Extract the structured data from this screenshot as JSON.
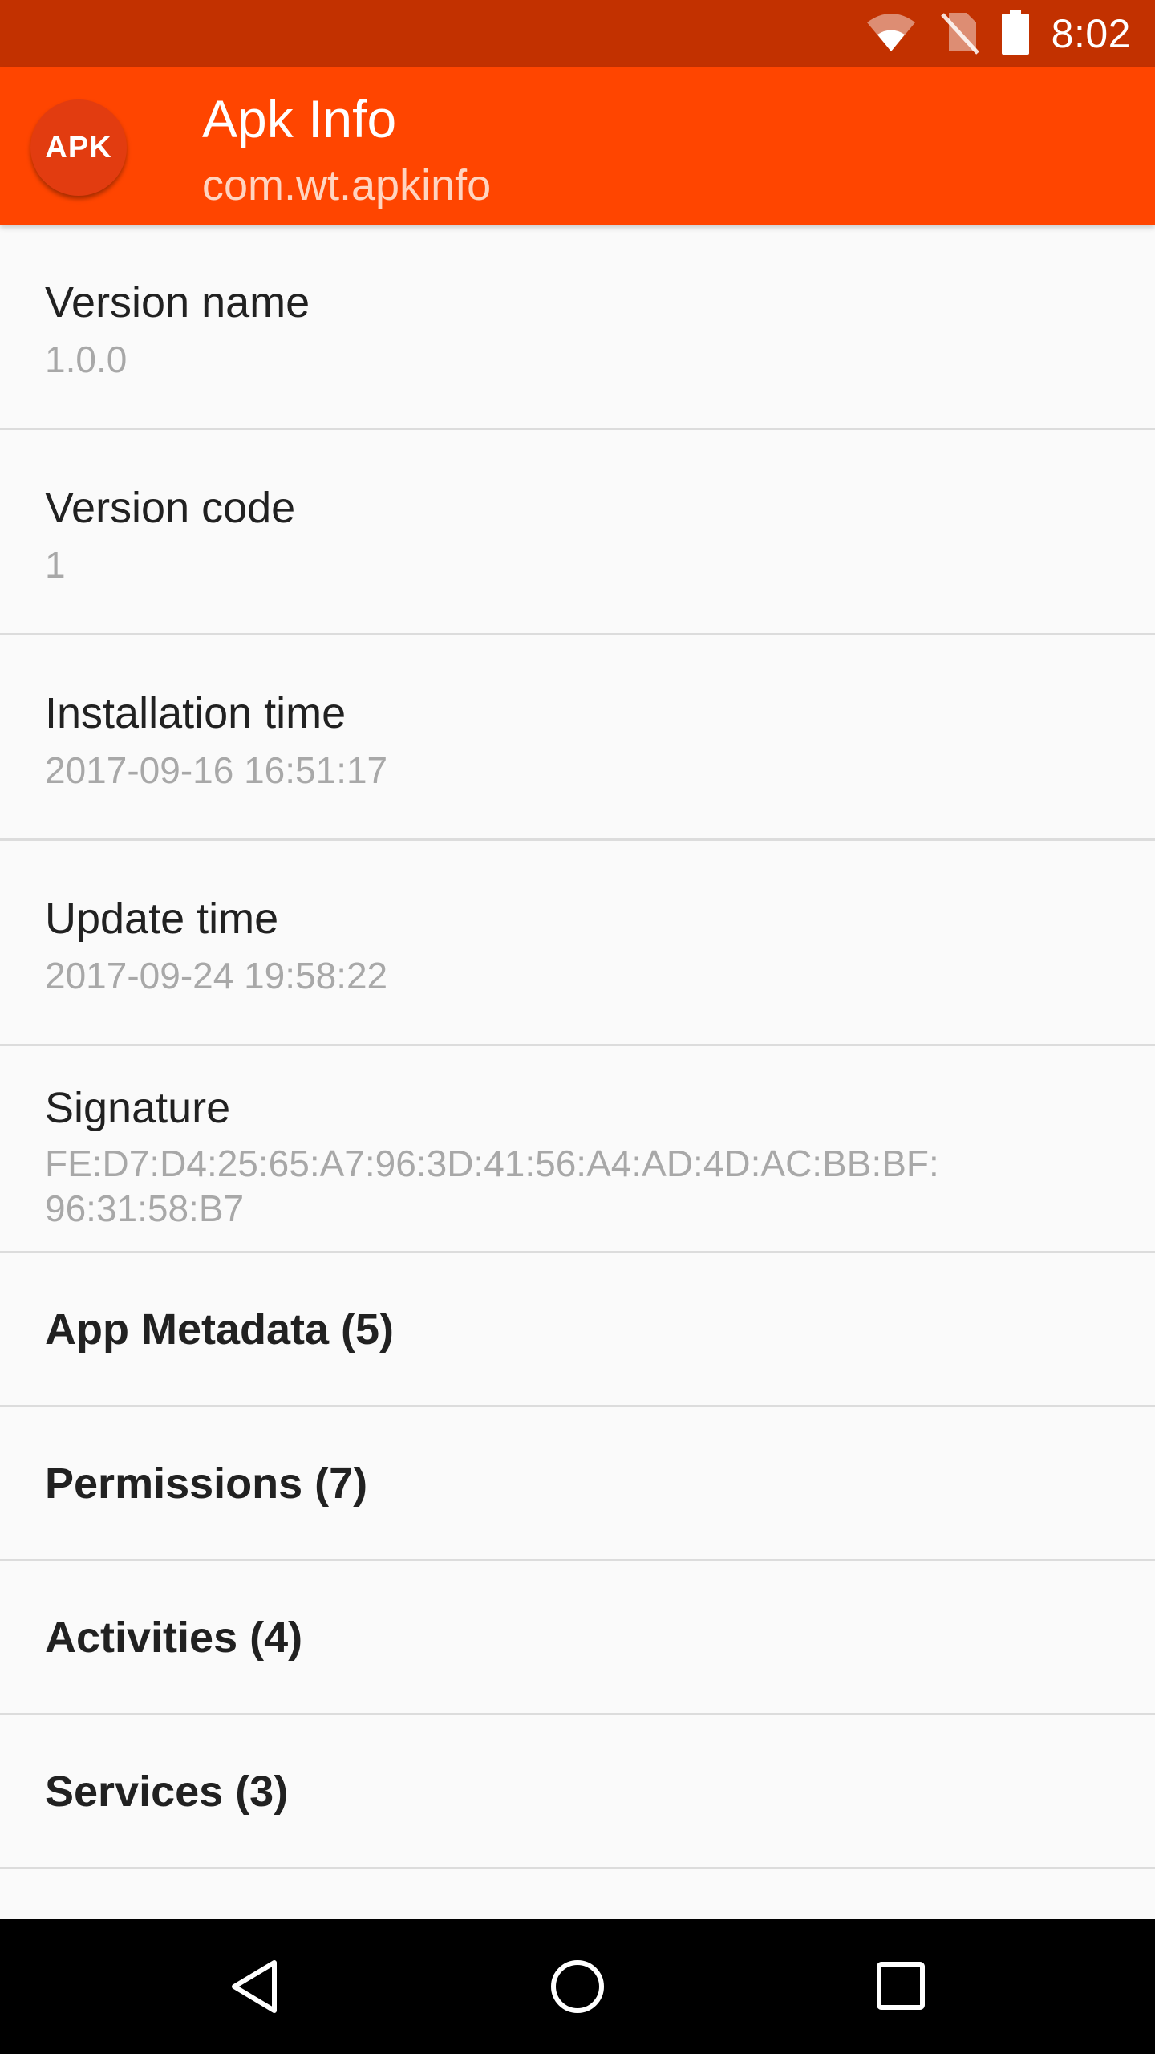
{
  "status_bar": {
    "time": "8:02",
    "icons": [
      "wifi-icon",
      "no-sim-icon",
      "battery-icon"
    ]
  },
  "app_bar": {
    "logo_text": "APK",
    "title": "Apk Info",
    "subtitle": "com.wt.apkinfo"
  },
  "details": {
    "version_name": {
      "label": "Version name",
      "value": "1.0.0"
    },
    "version_code": {
      "label": "Version code",
      "value": "1"
    },
    "installation_time": {
      "label": "Installation time",
      "value": "2017-09-16 16:51:17"
    },
    "update_time": {
      "label": "Update time",
      "value": "2017-09-24 19:58:22"
    },
    "signature": {
      "label": "Signature",
      "value": "FE:D7:D4:25:65:A7:96:3D:41:56:A4:AD:4D:AC:BB:BF:\n96:31:58:B7"
    }
  },
  "sections": {
    "app_metadata": "App Metadata (5)",
    "permissions": "Permissions (7)",
    "activities": "Activities (4)",
    "services": "Services (3)"
  },
  "nav_bar": {
    "icons": [
      "back-icon",
      "home-icon",
      "recents-icon"
    ]
  },
  "colors": {
    "status_bar": "#c23100",
    "app_bar": "#ff4500",
    "background": "#fafafa",
    "divider": "#dcdcdc",
    "secondary_text": "#a8a8a8"
  }
}
